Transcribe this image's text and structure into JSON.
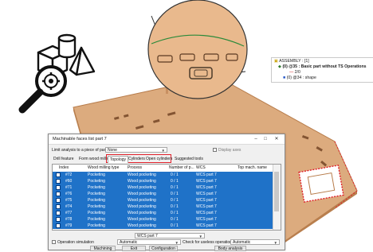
{
  "tree": {
    "line1": "ASSEMBLY : [1]",
    "line2": "(0) @35 : Basic part without TS Operations",
    "line3": "2/0",
    "line4": "(0) @34 : shape"
  },
  "dialog": {
    "title": "Machinable faces list part 7",
    "min": "–",
    "max": "□",
    "close": "✕",
    "limit_label": "Limit analysis to a piece of part :",
    "limit_value": "None",
    "display_axes": "Display axes",
    "tabs": [
      "Drill feature",
      "Form wood milling",
      "Topology",
      "Cylinders",
      "Open cylinders",
      "Suggested tools"
    ],
    "columns": [
      "Index",
      "Wood milling type",
      "Process",
      "Number of p...",
      "WCS",
      "Top mach. name"
    ],
    "rows": [
      [
        "#72",
        "Pocketing",
        "Wood pocketing",
        "0 / 1",
        "WCS part 7",
        ""
      ],
      [
        "#60",
        "Pocketing",
        "Wood pocketing",
        "0 / 1",
        "WCS part 7",
        ""
      ],
      [
        "#71",
        "Pocketing",
        "Wood pocketing",
        "0 / 1",
        "WCS part 7",
        ""
      ],
      [
        "#76",
        "Pocketing",
        "Wood pocketing",
        "0 / 1",
        "WCS part 7",
        ""
      ],
      [
        "#75",
        "Pocketing",
        "Wood pocketing",
        "0 / 1",
        "WCS part 7",
        ""
      ],
      [
        "#74",
        "Pocketing",
        "Wood pocketing",
        "0 / 1",
        "WCS part 7",
        ""
      ],
      [
        "#77",
        "Pocketing",
        "Wood pocketing",
        "0 / 1",
        "WCS part 7",
        ""
      ],
      [
        "#78",
        "Pocketing",
        "Wood pocketing",
        "0 / 1",
        "WCS part 7",
        ""
      ],
      [
        "#79",
        "Pocketing",
        "Wood pocketing",
        "0 / 1",
        "WCS part 7",
        ""
      ]
    ],
    "wcs_select": "WCS part 7",
    "op_sim": "Operation simulation",
    "automatic": "Automatic",
    "check_label": "Check for useless operations :",
    "automatic2": "Automatic",
    "buttons": [
      "Machining",
      "Exit",
      "Configuration",
      "Body analysis"
    ]
  },
  "colors": {
    "wood": "#d9a77a",
    "wood_edge": "#b97f4e",
    "selection": "#1f72c8",
    "highlight": "#e0202a"
  }
}
